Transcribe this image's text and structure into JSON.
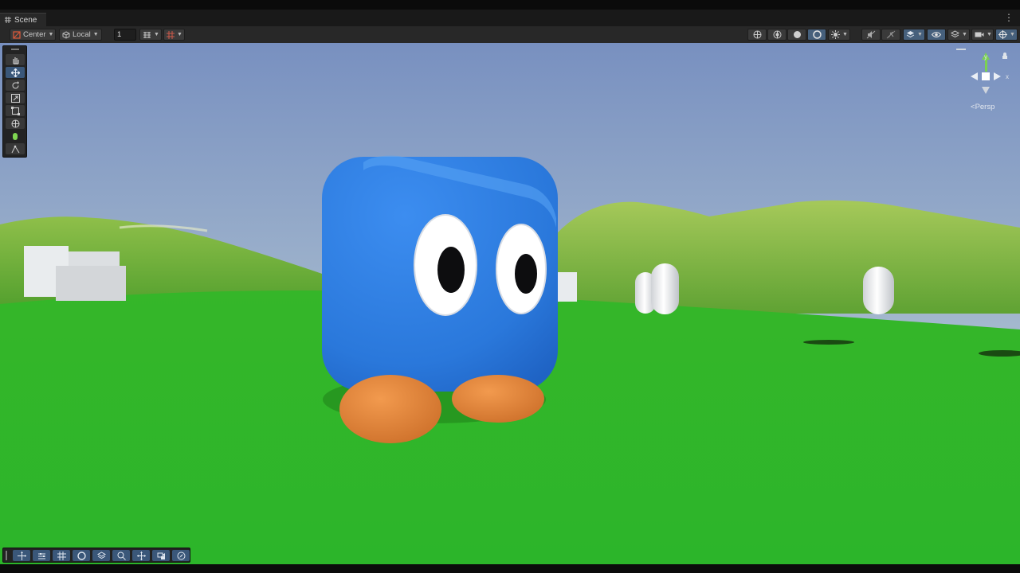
{
  "window": {
    "tab_label": "Scene"
  },
  "toolbar": {
    "pivot_label": "Center",
    "space_label": "Local",
    "grid_size_value": "1",
    "left_icons": [
      "snap-icon",
      "grid-icon"
    ],
    "right_icons": [
      "globe-icon",
      "wireframe-icon",
      "shaded-icon",
      "unlit-icon",
      "light-icon",
      "audio-off-icon",
      "fx-off-icon",
      "layers-icon",
      "visibility-icon",
      "effects-icon",
      "camera-icon",
      "gizmos-icon"
    ]
  },
  "tools": [
    "hand-tool-icon",
    "move-tool-icon",
    "rotate-tool-icon",
    "scale-tool-icon",
    "rect-tool-icon",
    "transform-tool-icon",
    "custom-tool-icon",
    "probe-tool-icon"
  ],
  "gizmo": {
    "y_label": "y",
    "x_label": "x",
    "projection_label": "Persp"
  },
  "overlays": [
    "orient-icon",
    "settings-icon",
    "grid-overlay-icon",
    "sphere-icon",
    "layers-overlay-icon",
    "search-icon",
    "move-overlay-icon",
    "camera-overlay-icon",
    "compass-icon"
  ],
  "colors": {
    "sky_top": "#7892c0",
    "sky_horizon": "#c2d2da",
    "grass": "#2fb82c",
    "cube": "#2f7fe0",
    "feet": "#e98a3d",
    "accent": "#46607c"
  }
}
